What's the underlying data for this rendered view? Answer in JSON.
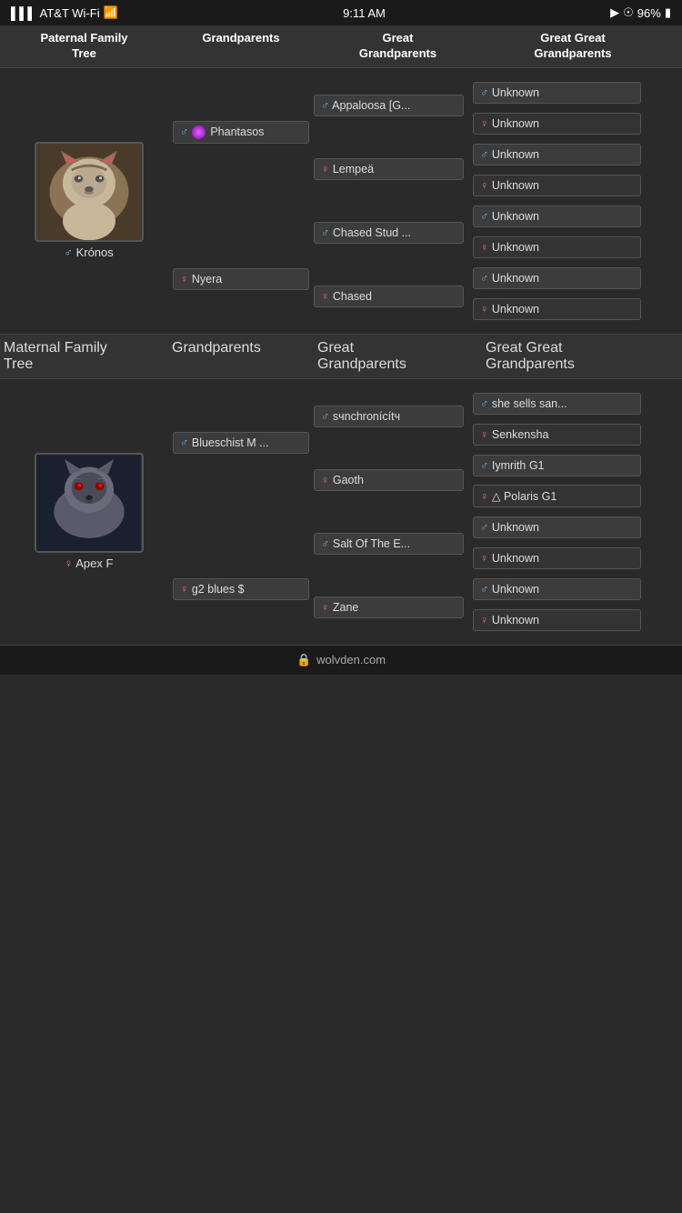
{
  "statusBar": {
    "carrier": "AT&T Wi-Fi",
    "time": "9:11 AM",
    "battery": "96%"
  },
  "paternal": {
    "header": {
      "col1": "Paternal Family\nTree",
      "col2": "Grandparents",
      "col3": "Great\nGrandparents",
      "col4": "Great Great\nGrandparents"
    },
    "subject": {
      "name": "Krónos",
      "gender": "male"
    },
    "grandparents": {
      "paternal": {
        "name": "Phantasos",
        "gender": "male",
        "special": true
      },
      "maternal": {
        "name": "Nyera",
        "gender": "female"
      }
    },
    "greatGrandparents": [
      {
        "name": "Appaloosa [G...",
        "gender": "male"
      },
      {
        "name": "Lempeä",
        "gender": "female"
      },
      {
        "name": "Chased Stud ...",
        "gender": "male"
      },
      {
        "name": "Chased",
        "gender": "female"
      }
    ],
    "greatGreatGrandparents": [
      {
        "name": "Unknown",
        "gender": "male"
      },
      {
        "name": "Unknown",
        "gender": "female"
      },
      {
        "name": "Unknown",
        "gender": "male"
      },
      {
        "name": "Unknown",
        "gender": "female"
      },
      {
        "name": "Unknown",
        "gender": "male"
      },
      {
        "name": "Unknown",
        "gender": "female"
      },
      {
        "name": "Unknown",
        "gender": "male"
      },
      {
        "name": "Unknown",
        "gender": "female"
      }
    ]
  },
  "maternal": {
    "header": {
      "col1": "Maternal Family\nTree",
      "col2": "Grandparents",
      "col3": "Great\nGrandparents",
      "col4": "Great Great\nGrandparents"
    },
    "subject": {
      "name": "Apex F",
      "gender": "female"
    },
    "grandparents": {
      "paternal": {
        "name": "Blueschist M ...",
        "gender": "male"
      },
      "maternal": {
        "name": "g2 blues $",
        "gender": "female"
      }
    },
    "greatGrandparents": [
      {
        "name": "sчnchronícítч",
        "gender": "male"
      },
      {
        "name": "Gaoth",
        "gender": "female"
      },
      {
        "name": "Salt Of The E...",
        "gender": "male"
      },
      {
        "name": "Zane",
        "gender": "female"
      }
    ],
    "greatGreatGrandparents": [
      {
        "name": "she sells san...",
        "gender": "male"
      },
      {
        "name": "Senkensha",
        "gender": "female"
      },
      {
        "name": "Iymrith G1",
        "gender": "male"
      },
      {
        "name": "△ Polaris G1",
        "gender": "female"
      },
      {
        "name": "Unknown",
        "gender": "male"
      },
      {
        "name": "Unknown",
        "gender": "female"
      },
      {
        "name": "Unknown",
        "gender": "male"
      },
      {
        "name": "Unknown",
        "gender": "female"
      }
    ]
  },
  "footer": {
    "text": "wolvden.com"
  }
}
